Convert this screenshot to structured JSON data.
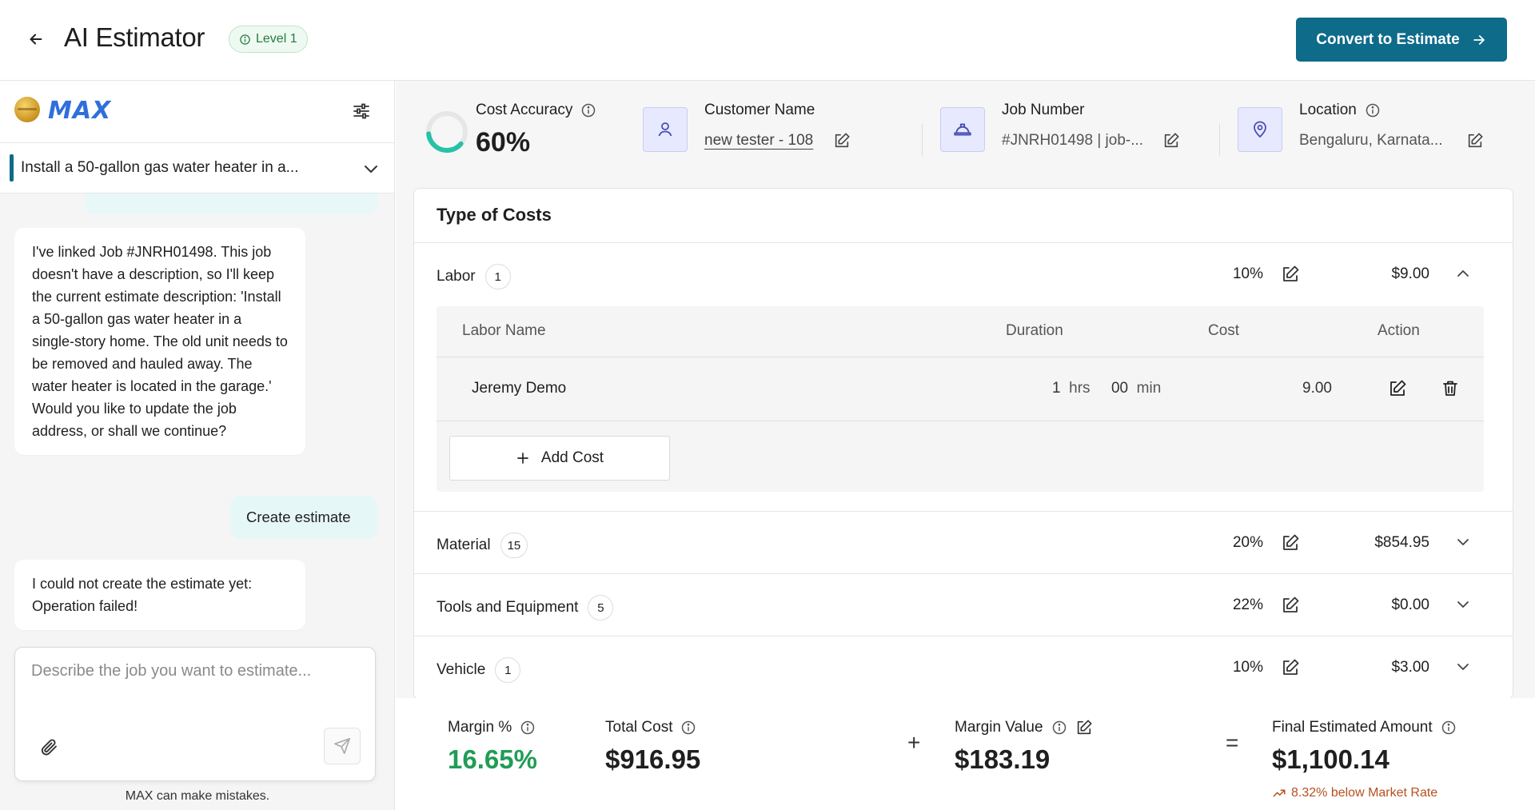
{
  "header": {
    "title": "AI Estimator",
    "level_badge": "Level 1",
    "convert_button": "Convert to Estimate"
  },
  "sidebar": {
    "brand": "MAX",
    "thread_title": "Install a 50-gallon gas water heater in a...",
    "messages": [
      {
        "role": "bot",
        "text": "I've linked Job #JNRH01498. This job doesn't have a description, so I'll keep the current estimate description: 'Install a 50-gallon gas water heater in a single-story home. The old unit needs to be removed and hauled away. The water heater is located in the garage.' Would you like to update the job address, or shall we continue?"
      },
      {
        "role": "user",
        "text": "Create estimate"
      },
      {
        "role": "bot",
        "text": "I could not create the estimate yet: Operation failed!"
      }
    ],
    "composer_placeholder": "Describe the job you want to estimate...",
    "disclaimer": "MAX can make mistakes."
  },
  "info": {
    "cost_accuracy_label": "Cost Accuracy",
    "cost_accuracy_value": "60%",
    "cost_accuracy_fraction": 0.6,
    "customer_label": "Customer Name",
    "customer_value": "new tester - 108",
    "job_label": "Job Number",
    "job_value": "#JNRH01498 | job-...",
    "location_label": "Location",
    "location_value": "Bengaluru, Karnata..."
  },
  "costs": {
    "title": "Type of Costs",
    "rows": [
      {
        "name": "Labor",
        "count": "1",
        "percent": "10%",
        "amount": "$9.00"
      },
      {
        "name": "Material",
        "count": "15",
        "percent": "20%",
        "amount": "$854.95"
      },
      {
        "name": "Tools and Equipment",
        "count": "5",
        "percent": "22%",
        "amount": "$0.00"
      },
      {
        "name": "Vehicle",
        "count": "1",
        "percent": "10%",
        "amount": "$3.00"
      }
    ],
    "labor_table": {
      "headers": {
        "name": "Labor Name",
        "duration": "Duration",
        "cost": "Cost",
        "action": "Action"
      },
      "row": {
        "name": "Jeremy Demo",
        "hours": "1",
        "hrs_unit": "hrs",
        "minutes": "00",
        "min_unit": "min",
        "cost": "9.00"
      },
      "add_cost": "Add Cost"
    }
  },
  "summary": {
    "margin_pct_label": "Margin %",
    "margin_pct_value": "16.65%",
    "total_cost_label": "Total Cost",
    "total_cost_value": "$916.95",
    "margin_value_label": "Margin Value",
    "margin_value_value": "$183.19",
    "final_label": "Final Estimated Amount",
    "final_value": "$1,100.14",
    "market_note": "8.32% below Market Rate",
    "plus": "+",
    "equals": "="
  },
  "colors": {
    "primary": "#0e6b8a",
    "accuracy_ring": "#26c2a6",
    "margin_green": "#1f9d55",
    "market_note": "#b5501f",
    "brand_blue": "#2f6fdc"
  }
}
